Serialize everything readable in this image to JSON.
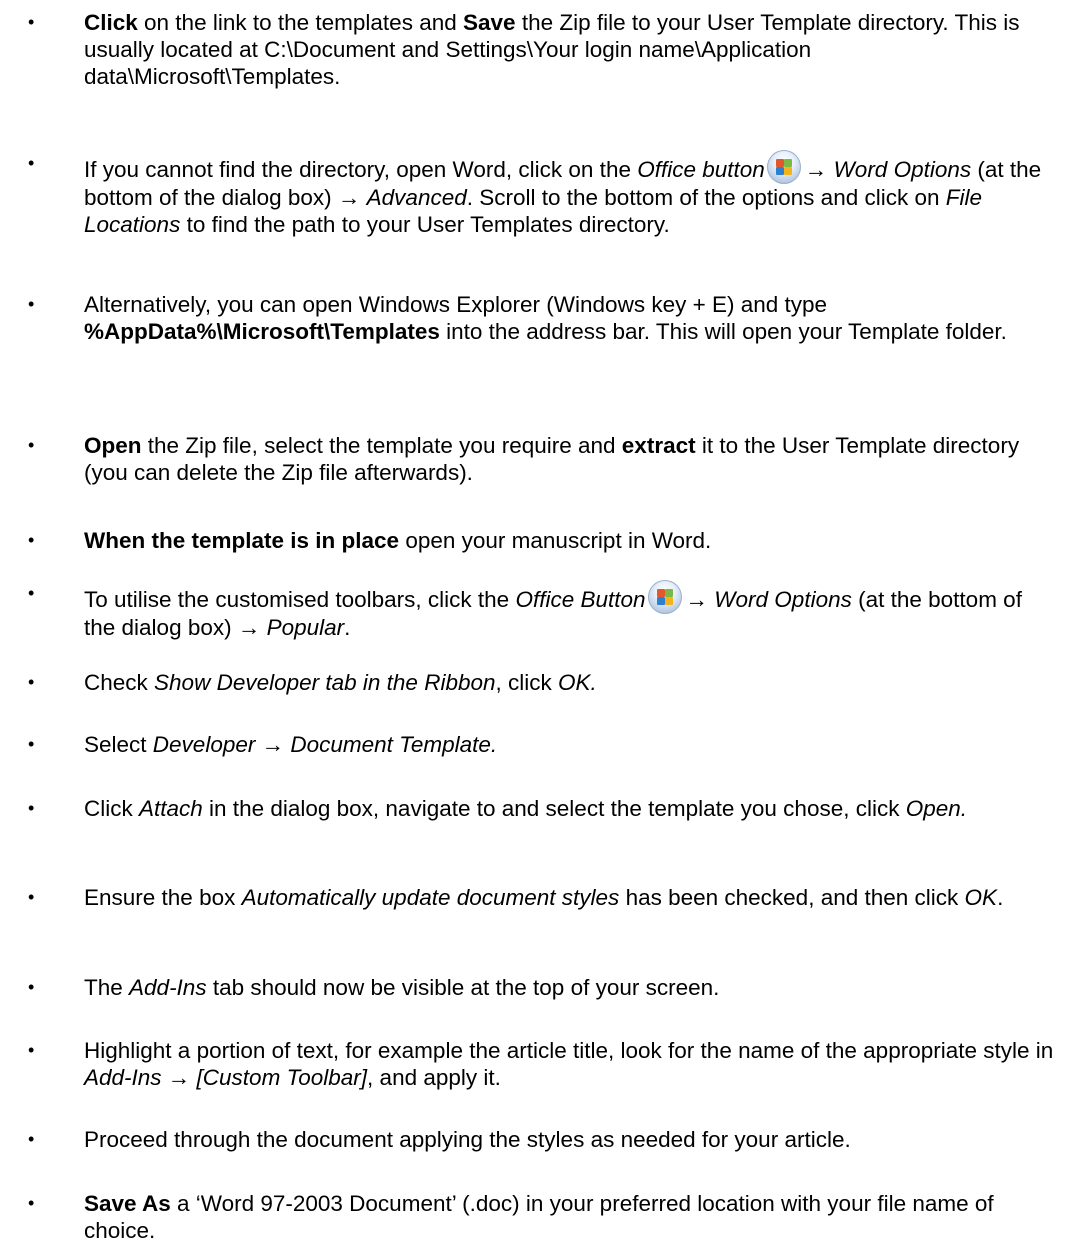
{
  "items": [
    {
      "parts": [
        {
          "t": "Click",
          "s": "b"
        },
        {
          "t": " on the link to the templates and "
        },
        {
          "t": "Save",
          "s": "b"
        },
        {
          "t": " the Zip file to your User Template directory. This is usually located at C:\\Document and Settings\\Your login name\\Application data\\Microsoft\\Templates."
        }
      ]
    },
    {
      "parts": [
        {
          "t": "If you cannot find the directory, open Word, click on the "
        },
        {
          "t": "Office button",
          "s": "i"
        },
        {
          "icon": "office-button-icon"
        },
        {
          "t": "→ "
        },
        {
          "t": "Word Options",
          "s": "i"
        },
        {
          "t": " (at the bottom of the dialog box) → "
        },
        {
          "t": "Advanced",
          "s": "i"
        },
        {
          "t": ". Scroll to the bottom of the options and click on "
        },
        {
          "t": "File Locations",
          "s": "i"
        },
        {
          "t": " to find the path to your User Templates directory."
        }
      ]
    },
    {
      "parts": [
        {
          "t": "Alternatively, you can open Windows Explorer (Windows key + E) and type "
        },
        {
          "t": "%AppData%\\Microsoft\\Templates",
          "s": "b"
        },
        {
          "t": " into the address bar. This will open your Template folder."
        }
      ]
    },
    {
      "parts": [
        {
          "t": "Open",
          "s": "b"
        },
        {
          "t": " the Zip file, select the template you require and "
        },
        {
          "t": "extract",
          "s": "b"
        },
        {
          "t": " it to the User Template directory (you can delete the Zip file afterwards)."
        }
      ]
    },
    {
      "parts": [
        {
          "t": "When the template is in place",
          "s": "b"
        },
        {
          "t": " open your manuscript in Word."
        }
      ]
    },
    {
      "parts": [
        {
          "t": "To utilise the customised toolbars, click the "
        },
        {
          "t": "Office Button",
          "s": "i"
        },
        {
          "icon": "office-button-icon"
        },
        {
          "t": "→ "
        },
        {
          "t": "Word Options",
          "s": "i"
        },
        {
          "t": " (at the bottom of the dialog box) → "
        },
        {
          "t": "Popular",
          "s": "i"
        },
        {
          "t": "."
        }
      ]
    },
    {
      "parts": [
        {
          "t": "Check "
        },
        {
          "t": "Show Developer tab in the Ribbon",
          "s": "i"
        },
        {
          "t": ", click "
        },
        {
          "t": "OK.",
          "s": "i"
        }
      ]
    },
    {
      "parts": [
        {
          "t": "Select "
        },
        {
          "t": "Developer → Document Template.",
          "s": "i"
        }
      ]
    },
    {
      "parts": [
        {
          "t": "Click "
        },
        {
          "t": "Attach",
          "s": "i"
        },
        {
          "t": " in the dialog box, navigate to and select the template you chose, click "
        },
        {
          "t": "Open.",
          "s": "i"
        }
      ]
    },
    {
      "parts": [
        {
          "t": "Ensure the box "
        },
        {
          "t": "Automatically update document styles",
          "s": "i"
        },
        {
          "t": " has been checked, and then click "
        },
        {
          "t": "OK",
          "s": "i"
        },
        {
          "t": "."
        }
      ]
    },
    {
      "parts": [
        {
          "t": "The "
        },
        {
          "t": "Add-Ins",
          "s": "i"
        },
        {
          "t": " tab should now be visible at the top of your screen."
        }
      ]
    },
    {
      "parts": [
        {
          "t": "Highlight a portion of text, for example the article title, look for the name of the appropriate style in "
        },
        {
          "t": "Add-Ins → [Custom Toolbar]",
          "s": "i"
        },
        {
          "t": ", and apply it."
        }
      ]
    },
    {
      "parts": [
        {
          "t": "Proceed through the document applying the styles as needed for your article."
        }
      ]
    },
    {
      "parts": [
        {
          "t": "Save As",
          "s": "b"
        },
        {
          "t": " a ‘Word 97-2003 Document’ (.doc) in your preferred location with your file name of choice."
        }
      ]
    }
  ]
}
